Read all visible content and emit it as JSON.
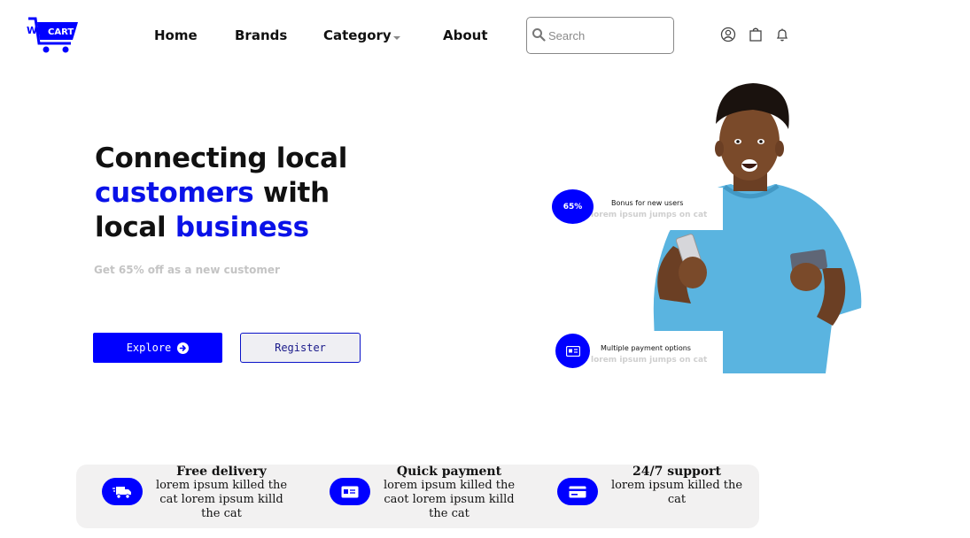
{
  "brand": {
    "logo_prefix": "Wi",
    "logo_word": "CART",
    "accent": "#0000ff"
  },
  "nav": {
    "home": "Home",
    "brands": "Brands",
    "category": "Category",
    "about": "About"
  },
  "search": {
    "placeholder": "Search"
  },
  "header_icons": [
    "user-icon",
    "shopping-bag-icon",
    "bell-icon"
  ],
  "hero": {
    "line1": "Connecting local",
    "line2_blue": "customers",
    "line2_rest": " with",
    "line3_plain": "local ",
    "line3_blue": "business",
    "subtext": "Get 65% off as a new customer",
    "explore_label": "Explore",
    "register_label": "Register"
  },
  "promo": {
    "bonus_badge": "65%",
    "bonus_title": "Bonus for new users",
    "bonus_sub": "lorem ipsum jumps on cat",
    "payment_title": "Multiple payment options",
    "payment_sub": "lorem ipsum jumps on cat"
  },
  "features": [
    {
      "icon": "truck-icon",
      "title": "Free delivery",
      "desc": "lorem ipsum killed the cat lorem ipsum killd the cat"
    },
    {
      "icon": "id-card-icon",
      "title": "Quick payment",
      "desc": "lorem ipsum killed the caot lorem ipsum killd the cat"
    },
    {
      "icon": "credit-card-icon",
      "title": "24/7 support",
      "desc": "lorem ipsum killed the cat"
    }
  ]
}
